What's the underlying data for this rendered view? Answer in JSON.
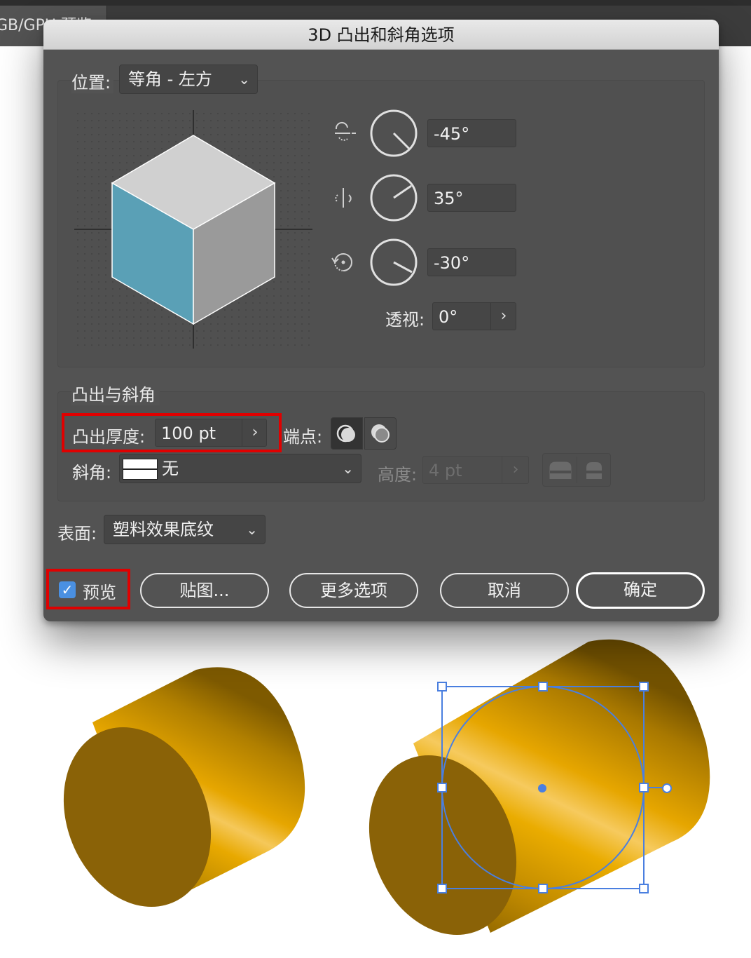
{
  "app": {
    "doc_tab": "GB/GPU 预览"
  },
  "dialog": {
    "title": "3D 凸出和斜角选项",
    "position": {
      "label": "位置:",
      "value": "等角 - 左方"
    },
    "rotation": [
      {
        "axis": "x",
        "value": "-45°"
      },
      {
        "axis": "y",
        "value": "35°"
      },
      {
        "axis": "z",
        "value": "-30°"
      }
    ],
    "perspective": {
      "label": "透视:",
      "value": "0°"
    },
    "extrude_section": {
      "title": "凸出与斜角",
      "depth_label": "凸出厚度:",
      "depth_value": "100 pt",
      "cap_label": "端点:",
      "bevel_label": "斜角:",
      "bevel_value": "无",
      "height_label": "高度:",
      "height_value": "4 pt"
    },
    "surface": {
      "label": "表面:",
      "value": "塑料效果底纹"
    },
    "preview": {
      "label": "预览",
      "checked": true
    },
    "buttons": {
      "map_art": "贴图...",
      "more_options": "更多选项",
      "cancel": "取消",
      "ok": "确定"
    }
  },
  "colors": {
    "dialog_bg": "#535353",
    "cube_top": "#d0d0d0",
    "cube_left": "#5aa0b6",
    "cube_right": "#9a9a9a",
    "highlight": "#e00000",
    "cylinder_gold": "#e6a800",
    "selection_blue": "#4a7fe0",
    "checkbox_blue": "#4a90e2"
  }
}
